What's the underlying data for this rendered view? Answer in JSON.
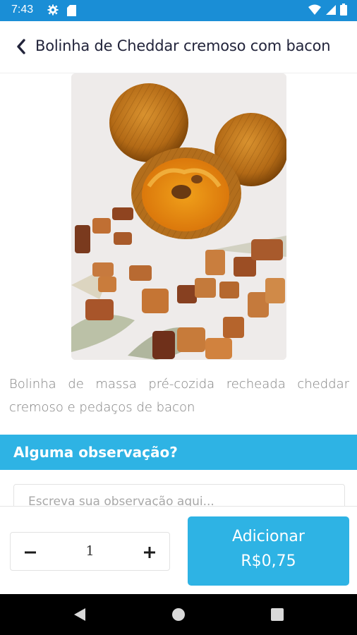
{
  "status_bar": {
    "time": "7:43",
    "icons": [
      "settings-gear-icon",
      "sd-card-icon",
      "wifi-icon",
      "signal-icon",
      "battery-icon"
    ],
    "color": "#1a8ed6"
  },
  "header": {
    "title": "Bolinha de Cheddar cremoso com bacon",
    "back_icon": "chevron-left-icon"
  },
  "product": {
    "image_alt": "Bolinha de Cheddar cremoso com bacon",
    "description": "Bolinha de massa pré-cozida recheada cheddar cremoso e pedaços de bacon"
  },
  "observation": {
    "title": "Alguma observação?",
    "placeholder": "Escreva sua observação aqui...",
    "value": ""
  },
  "order": {
    "quantity": "1",
    "minus_icon": "minus-icon",
    "plus_icon": "plus-icon",
    "add_label": "Adicionar",
    "price": "R$0,75"
  },
  "nav_bar": {
    "icons": [
      "nav-back-icon",
      "nav-home-icon",
      "nav-recents-icon"
    ]
  },
  "colors": {
    "accent": "#2eb3e4",
    "status_bar": "#1a8ed6",
    "title_text": "#22243b",
    "description_text": "#808080"
  }
}
